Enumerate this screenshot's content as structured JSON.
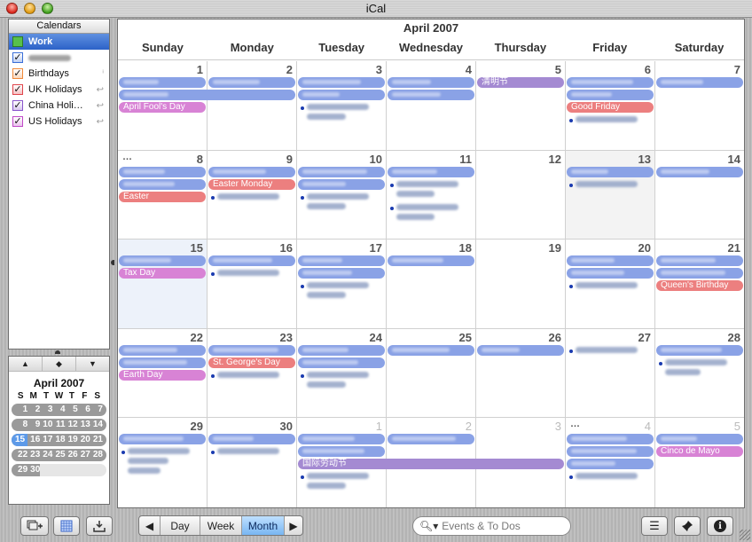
{
  "window": {
    "title": "iCal"
  },
  "sidebar": {
    "header": "Calendars",
    "items": [
      {
        "label": "Work",
        "color": "#58c04a",
        "checked": true,
        "selected": true,
        "badge": ""
      },
      {
        "label": "",
        "color": "#3b6fd8",
        "checked": true,
        "selected": false,
        "badge": "",
        "redacted": true
      },
      {
        "label": "Birthdays",
        "color": "#f08a3a",
        "checked": true,
        "selected": false,
        "badge": "i"
      },
      {
        "label": "UK Holidays",
        "color": "#e0444a",
        "checked": true,
        "selected": false,
        "badge": "subscribed"
      },
      {
        "label": "China Holi…",
        "color": "#8a55cc",
        "checked": true,
        "selected": false,
        "badge": "subscribed"
      },
      {
        "label": "US Holidays",
        "color": "#c04ac8",
        "checked": true,
        "selected": false,
        "badge": "subscribed"
      }
    ]
  },
  "mini_calendar": {
    "nav": {
      "prev": "▲",
      "today": "◆",
      "next": "▼"
    },
    "title": "April 2007",
    "dow": [
      "S",
      "M",
      "T",
      "W",
      "T",
      "F",
      "S"
    ],
    "weeks": [
      [
        "1",
        "2",
        "3",
        "4",
        "5",
        "6",
        "7"
      ],
      [
        "8",
        "9",
        "10",
        "11",
        "12",
        "13",
        "14"
      ],
      [
        "15",
        "16",
        "17",
        "18",
        "19",
        "20",
        "21"
      ],
      [
        "22",
        "23",
        "24",
        "25",
        "26",
        "27",
        "28"
      ],
      [
        "29",
        "30",
        "",
        "",
        "",
        "",
        ""
      ]
    ],
    "today": "15"
  },
  "main": {
    "title": "April 2007",
    "dow": [
      "Sunday",
      "Monday",
      "Tuesday",
      "Wednesday",
      "Thursday",
      "Friday",
      "Saturday"
    ],
    "weeks": [
      {
        "days": [
          {
            "num": "1",
            "events": [
              {
                "t": "work",
                "r": 1
              },
              {
                "t": "work",
                "r": 1,
                "span": 2
              },
              {
                "t": "pink",
                "label": "April Fool's Day"
              }
            ]
          },
          {
            "num": "2",
            "events": [
              {
                "t": "work",
                "r": 1
              },
              {
                "t": "skip"
              }
            ]
          },
          {
            "num": "3",
            "events": [
              {
                "t": "work",
                "r": 1
              },
              {
                "t": "work",
                "r": 1
              }
            ],
            "timed": [
              2
            ]
          },
          {
            "num": "4",
            "events": [
              {
                "t": "work",
                "r": 1
              },
              {
                "t": "work",
                "r": 1
              }
            ]
          },
          {
            "num": "5",
            "events": [
              {
                "t": "purple",
                "label": "清明节"
              }
            ]
          },
          {
            "num": "6",
            "events": [
              {
                "t": "work",
                "r": 1
              },
              {
                "t": "work",
                "r": 1
              },
              {
                "t": "red",
                "label": "Good Friday"
              }
            ],
            "timed": [
              1
            ]
          },
          {
            "num": "7",
            "events": [
              {
                "t": "work",
                "r": 1
              }
            ]
          }
        ]
      },
      {
        "days": [
          {
            "num": "8",
            "more": "…",
            "events": [
              {
                "t": "work",
                "r": 1
              },
              {
                "t": "work",
                "r": 1
              },
              {
                "t": "red",
                "label": "Easter"
              }
            ]
          },
          {
            "num": "9",
            "events": [
              {
                "t": "work",
                "r": 1
              },
              {
                "t": "red",
                "label": "Easter Monday"
              }
            ],
            "timed": [
              1
            ]
          },
          {
            "num": "10",
            "events": [
              {
                "t": "work",
                "r": 1
              },
              {
                "t": "work",
                "r": 1
              }
            ],
            "timed": [
              2
            ]
          },
          {
            "num": "11",
            "events": [
              {
                "t": "work",
                "r": 1
              }
            ],
            "timed": [
              2,
              2
            ]
          },
          {
            "num": "12",
            "events": []
          },
          {
            "num": "13",
            "shade": true,
            "events": [
              {
                "t": "work",
                "r": 1
              }
            ],
            "timed": [
              1
            ]
          },
          {
            "num": "14",
            "events": [
              {
                "t": "work",
                "r": 1
              }
            ]
          }
        ]
      },
      {
        "days": [
          {
            "num": "15",
            "today": true,
            "events": [
              {
                "t": "work",
                "r": 1
              },
              {
                "t": "pink",
                "label": "Tax Day"
              }
            ]
          },
          {
            "num": "16",
            "events": [
              {
                "t": "work",
                "r": 1
              }
            ],
            "timed": [
              1
            ]
          },
          {
            "num": "17",
            "events": [
              {
                "t": "work",
                "r": 1
              },
              {
                "t": "work",
                "r": 1
              }
            ],
            "timed": [
              2
            ]
          },
          {
            "num": "18",
            "events": [
              {
                "t": "work",
                "r": 1
              }
            ]
          },
          {
            "num": "19",
            "events": []
          },
          {
            "num": "20",
            "events": [
              {
                "t": "work",
                "r": 1
              },
              {
                "t": "work",
                "r": 1
              }
            ],
            "timed": [
              1
            ]
          },
          {
            "num": "21",
            "events": [
              {
                "t": "work",
                "r": 1
              },
              {
                "t": "work",
                "r": 1
              },
              {
                "t": "red",
                "label": "Queen's Birthday"
              }
            ]
          }
        ]
      },
      {
        "days": [
          {
            "num": "22",
            "events": [
              {
                "t": "work",
                "r": 1
              },
              {
                "t": "work",
                "r": 1
              },
              {
                "t": "pink",
                "label": "Earth Day"
              }
            ]
          },
          {
            "num": "23",
            "events": [
              {
                "t": "work",
                "r": 1
              },
              {
                "t": "red",
                "label": "St. George's Day"
              }
            ],
            "timed": [
              1
            ]
          },
          {
            "num": "24",
            "events": [
              {
                "t": "work",
                "r": 1
              },
              {
                "t": "work",
                "r": 1
              }
            ],
            "timed": [
              2
            ]
          },
          {
            "num": "25",
            "events": [
              {
                "t": "work",
                "r": 1
              }
            ]
          },
          {
            "num": "26",
            "events": [
              {
                "t": "work",
                "r": 1
              }
            ]
          },
          {
            "num": "27",
            "events": [],
            "timed": [
              1
            ]
          },
          {
            "num": "28",
            "events": [
              {
                "t": "work",
                "r": 1
              }
            ],
            "timed": [
              2
            ]
          }
        ]
      },
      {
        "days": [
          {
            "num": "29",
            "events": [
              {
                "t": "work",
                "r": 1
              }
            ],
            "timed": [
              3
            ]
          },
          {
            "num": "30",
            "events": [
              {
                "t": "work",
                "r": 1
              }
            ],
            "timed": [
              1
            ]
          },
          {
            "num": "1",
            "other": true,
            "events": [
              {
                "t": "work",
                "r": 1
              },
              {
                "t": "work",
                "r": 1
              },
              {
                "t": "purple",
                "label": "国际劳动节",
                "span": 3
              }
            ],
            "timed": [
              2
            ]
          },
          {
            "num": "2",
            "other": true,
            "events": [
              {
                "t": "work",
                "r": 1
              }
            ]
          },
          {
            "num": "3",
            "other": true,
            "events": []
          },
          {
            "num": "4",
            "other": true,
            "more": "…",
            "events": [
              {
                "t": "work",
                "r": 1
              },
              {
                "t": "work",
                "r": 1
              },
              {
                "t": "work",
                "r": 1
              }
            ],
            "timed": [
              1
            ]
          },
          {
            "num": "5",
            "other": true,
            "events": [
              {
                "t": "work",
                "r": 1
              },
              {
                "t": "pink",
                "label": "Cinco de Mayo"
              }
            ]
          }
        ]
      }
    ]
  },
  "toolbar": {
    "add_calendar": "add-calendar",
    "show_calendar": "show-mini-calendar",
    "notifications": "notifications",
    "prev": "◀",
    "views": [
      "Day",
      "Week",
      "Month"
    ],
    "active_view": "Month",
    "next": "▶",
    "search_placeholder": "Events & To Dos",
    "todo_list": "☰",
    "pin": "📌",
    "info": "i"
  }
}
